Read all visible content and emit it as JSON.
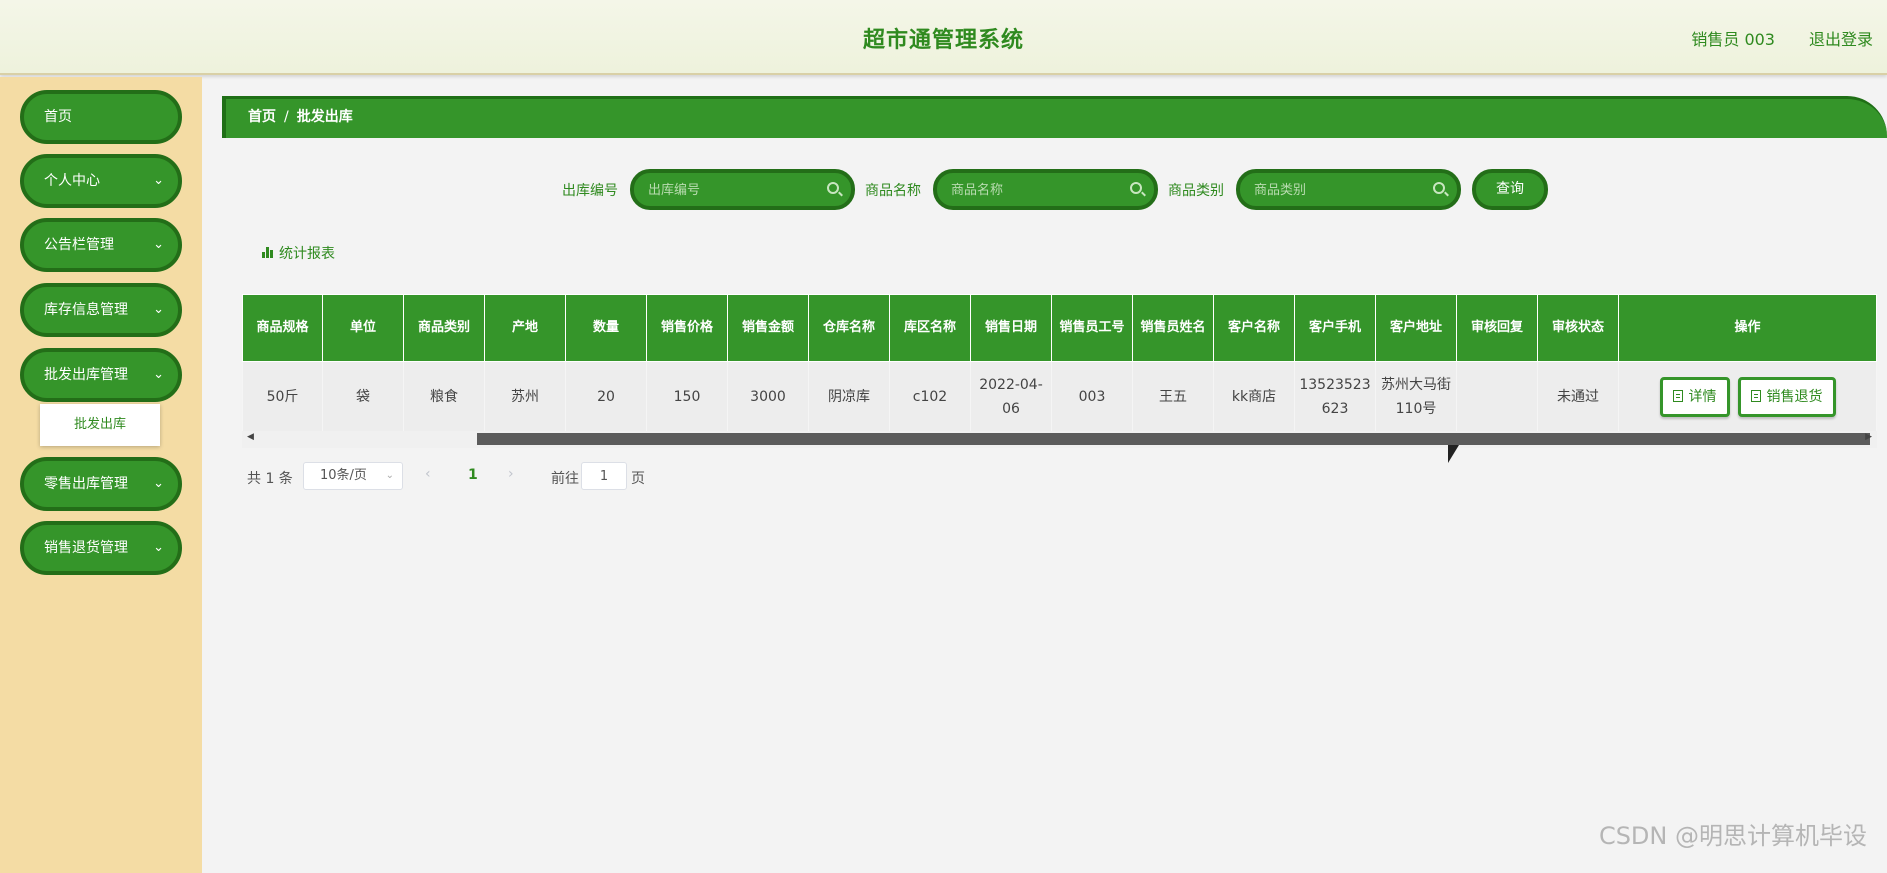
{
  "header": {
    "title": "超市通管理系统",
    "user": "销售员 003",
    "logout": "退出登录"
  },
  "sidebar": {
    "items": [
      {
        "label": "首页",
        "has_children": false
      },
      {
        "label": "个人中心",
        "has_children": true
      },
      {
        "label": "公告栏管理",
        "has_children": true
      },
      {
        "label": "库存信息管理",
        "has_children": true
      },
      {
        "label": "批发出库管理",
        "has_children": true
      },
      {
        "label": "零售出库管理",
        "has_children": true
      },
      {
        "label": "销售退货管理",
        "has_children": true
      }
    ],
    "sub_item": "批发出库"
  },
  "breadcrumb": {
    "home": "首页",
    "separator": "/",
    "current": "批发出库"
  },
  "search": {
    "field1_label": "出库编号",
    "field1_placeholder": "出库编号",
    "field2_label": "商品名称",
    "field2_placeholder": "商品名称",
    "field3_label": "商品类别",
    "field3_placeholder": "商品类别",
    "query_button": "查询"
  },
  "stats_link": "统计报表",
  "table": {
    "headers": [
      "商品规格",
      "单位",
      "商品类别",
      "产地",
      "数量",
      "销售价格",
      "销售金额",
      "仓库名称",
      "库区名称",
      "销售日期",
      "销售员工号",
      "销售员姓名",
      "客户名称",
      "客户手机",
      "客户地址",
      "审核回复",
      "审核状态",
      "操作"
    ],
    "rows": [
      {
        "cells": [
          "50斤",
          "袋",
          "粮食",
          "苏州",
          "20",
          "150",
          "3000",
          "阴凉库",
          "c102",
          "2022-04-06",
          "003",
          "王五",
          "kk商店",
          "13523523623",
          "苏州大马街110号",
          "",
          "未通过"
        ],
        "actions": {
          "detail": "详情",
          "return": "销售退货"
        }
      }
    ]
  },
  "pagination": {
    "total": "共 1 条",
    "page_size": "10条/页",
    "current_page": "1",
    "goto_prefix": "前往",
    "goto_value": "1",
    "goto_suffix": "页"
  },
  "watermark": "CSDN @明思计算机毕设",
  "colors": {
    "primary": "#35952a",
    "primary_dark": "#236e18",
    "sidebar_bg": "#f4dca4",
    "text_green": "#2f8a1f"
  }
}
